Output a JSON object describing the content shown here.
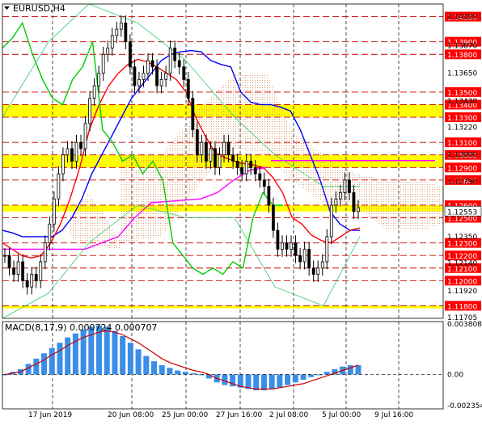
{
  "header": {
    "symbol_label": "EURUSD,H4",
    "menu_icon": "triangle-down-icon"
  },
  "macd_header": {
    "label": "MACD(8,17,9) 0.000724 0.000707"
  },
  "chart_data": [
    {
      "type": "candlestick",
      "title": "EURUSD,H4",
      "ylim": [
        1.117,
        1.142
      ],
      "y_tick_labels": [
        "1.14100",
        "1.13870",
        "1.13650",
        "1.13430",
        "1.13220",
        "1.13000",
        "1.12790",
        "1.12570",
        "1.12350",
        "1.12140",
        "1.11920",
        "1.11705"
      ],
      "levels": {
        "resistance": [
          "1.14100",
          "1.13900",
          "1.13800",
          "1.13500",
          "1.13400",
          "1.13300",
          "1.13100",
          "1.13000",
          "1.12900",
          "1.12800",
          "1.12600"
        ],
        "support": [
          "1.12500",
          "1.12300",
          "1.12200",
          "1.12100",
          "1.12000",
          "1.11800"
        ]
      },
      "current_price": "1.12553",
      "zones": [
        {
          "from": 1.133,
          "to": 1.134,
          "color": "#ffff00"
        },
        {
          "from": 1.129,
          "to": 1.13,
          "color": "#ffff00"
        },
        {
          "from": 1.1255,
          "to": 1.126,
          "color": "#ffff00"
        },
        {
          "from": 1.1178,
          "to": 1.118,
          "color": "#ffff00"
        }
      ],
      "x_labels": [
        "17 Jun 2019",
        "20 Jun 08:00",
        "25 Jun 00:00",
        "27 Jun 16:00",
        "2 Jul 08:00",
        "5 Jul 00:00",
        "9 Jul 16:00"
      ],
      "close_series": [
        1.122,
        1.121,
        1.1205,
        1.1215,
        1.12,
        1.1195,
        1.1205,
        1.12,
        1.1215,
        1.123,
        1.1245,
        1.1265,
        1.1285,
        1.13,
        1.1305,
        1.1295,
        1.131,
        1.1305,
        1.1325,
        1.1345,
        1.1355,
        1.1365,
        1.138,
        1.1385,
        1.1395,
        1.14,
        1.1405,
        1.139,
        1.137,
        1.1355,
        1.136,
        1.1365,
        1.1375,
        1.137,
        1.1355,
        1.136,
        1.1365,
        1.1385,
        1.1375,
        1.137,
        1.136,
        1.1345,
        1.132,
        1.13,
        1.131,
        1.1295,
        1.1305,
        1.129,
        1.13,
        1.131,
        1.13,
        1.1295,
        1.129,
        1.1285,
        1.1295,
        1.129,
        1.1285,
        1.128,
        1.1275,
        1.126,
        1.124,
        1.1225,
        1.123,
        1.1225,
        1.123,
        1.122,
        1.1215,
        1.1225,
        1.121,
        1.1205,
        1.121,
        1.1215,
        1.1235,
        1.126,
        1.1265,
        1.127,
        1.128,
        1.127,
        1.1255,
        1.1258
      ],
      "series": [
        {
          "name": "",
          "color": "#0000ff",
          "values": [
            1.124,
            1.1238,
            1.1235,
            1.1235,
            1.1235,
            1.1235,
            1.124,
            1.125,
            1.1265,
            1.1285,
            1.13,
            1.1315,
            1.133,
            1.1345,
            1.1355,
            1.1365,
            1.1375,
            1.138,
            1.1382,
            1.1383,
            1.1382,
            1.1375,
            1.1372,
            1.137,
            1.135,
            1.1342,
            1.134,
            1.134,
            1.1338,
            1.1335,
            1.132,
            1.13,
            1.128,
            1.1255,
            1.1245,
            1.124,
            1.124
          ]
        },
        {
          "name": "",
          "color": "#ff0000",
          "values": [
            1.123,
            1.1225,
            1.122,
            1.1218,
            1.122,
            1.123,
            1.1245,
            1.1265,
            1.129,
            1.132,
            1.134,
            1.1355,
            1.1365,
            1.1372,
            1.1376,
            1.1374,
            1.137,
            1.1365,
            1.136,
            1.135,
            1.133,
            1.1315,
            1.1302,
            1.1298,
            1.1295,
            1.1293,
            1.1292,
            1.129,
            1.1282,
            1.127,
            1.125,
            1.1245,
            1.1236,
            1.1232,
            1.123,
            1.1235,
            1.124,
            1.1242
          ]
        },
        {
          "name": "",
          "color": "#ff00ff",
          "values": [
            1.1225,
            1.1225,
            1.1225,
            1.1225,
            1.1225,
            1.1225,
            1.123,
            1.1235,
            1.125,
            1.1262,
            1.1263,
            1.1264,
            1.1265,
            1.127,
            1.128,
            1.1288,
            1.129
          ]
        },
        {
          "name": "",
          "color": "#00cc00",
          "values": [
            1.1385,
            1.1393,
            1.1405,
            1.138,
            1.136,
            1.1345,
            1.134,
            1.136,
            1.137,
            1.139,
            1.132,
            1.131,
            1.1295,
            1.13,
            1.1285,
            1.1295,
            1.128,
            1.123,
            1.122,
            1.121,
            1.1205,
            1.121,
            1.1205,
            1.1215,
            1.121,
            1.125,
            1.127,
            1.126,
            1.126
          ]
        }
      ]
    },
    {
      "type": "bar",
      "title": "MACD(8,17,9) 0.000724 0.000707",
      "ylim": [
        -0.0026,
        0.004
      ],
      "y_tick_labels": [
        "0.003808",
        "0.00",
        "-0.002354"
      ],
      "values": [
        0.0,
        0.0002,
        0.0004,
        0.0008,
        0.0012,
        0.0016,
        0.002,
        0.0024,
        0.0028,
        0.0031,
        0.0034,
        0.0036,
        0.0037,
        0.0036,
        0.0033,
        0.0029,
        0.0024,
        0.0019,
        0.0014,
        0.001,
        0.0007,
        0.0005,
        0.0003,
        0.0002,
        0.0001,
        0.0,
        -0.0003,
        -0.0006,
        -0.0008,
        -0.0009,
        -0.001,
        -0.0011,
        -0.0012,
        -0.0012,
        -0.0011,
        -0.001,
        -0.0008,
        -0.0006,
        -0.0004,
        -0.0002,
        0.0,
        0.0002,
        0.0004,
        0.0006,
        0.0007,
        0.0007
      ],
      "signal": [
        0.0,
        0.0001,
        0.0002,
        0.0005,
        0.0008,
        0.0011,
        0.0015,
        0.0018,
        0.0022,
        0.0025,
        0.0028,
        0.003,
        0.0032,
        0.0033,
        0.0032,
        0.003,
        0.0027,
        0.0024,
        0.002,
        0.0016,
        0.0012,
        0.0009,
        0.0007,
        0.0005,
        0.0003,
        0.0002,
        0.0,
        -0.0003,
        -0.0005,
        -0.0007,
        -0.0009,
        -0.001,
        -0.0011,
        -0.0011,
        -0.0011,
        -0.001,
        -0.0009,
        -0.0008,
        -0.0007,
        -0.0005,
        -0.0003,
        -0.0001,
        0.0001,
        0.0003,
        0.0005,
        0.0007
      ],
      "colors": {
        "histogram": "#3b8ee8",
        "signal": "#cc0000"
      }
    }
  ]
}
